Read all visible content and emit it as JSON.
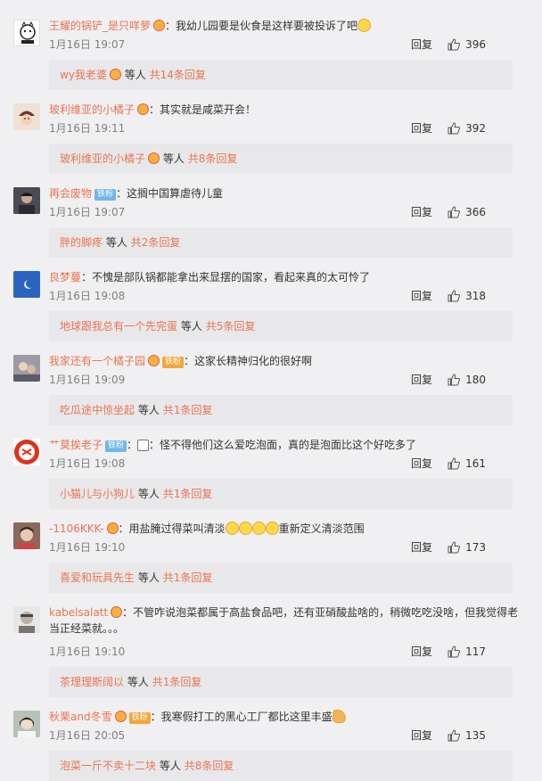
{
  "reply_label": "回复",
  "sub_mid": "等人",
  "comments": [
    {
      "user": "王耀的锅铲_是只咩萝",
      "badge": "v",
      "text": "：我幼儿园要是伙食是这样要被投诉了吧",
      "emoji": "sweat",
      "time": "1月16日 19:07",
      "likes": "396",
      "sub_user": "wy我老婆",
      "sub_badge": "v",
      "sub_count": "共14条回复",
      "avatar_color": "#ffffff"
    },
    {
      "user": "玻利维亚的小橘子",
      "badge": "v",
      "text": "：其实就是咸菜开会！",
      "time": "1月16日 19:11",
      "likes": "392",
      "sub_user": "玻利维亚的小橘子",
      "sub_badge": "v",
      "sub_count": "共8条回复",
      "avatar_color": "#e9d6c6"
    },
    {
      "user": "再会废物",
      "fan": "铁粉",
      "text": "：这搁中国算虐待儿童",
      "time": "1月16日 19:07",
      "likes": "366",
      "sub_user": "胖的脚疼",
      "sub_count": "共2条回复",
      "avatar_color": "#3a3c44"
    },
    {
      "user": "良梦蔓",
      "text": "：不愧是部队锅都能拿出来显摆的国家，看起来真的太可怜了",
      "time": "1月16日 19:08",
      "likes": "318",
      "sub_user": "地球跟我总有一个先完蛋",
      "sub_count": "共5条回复",
      "avatar_color": "#2f6fc7"
    },
    {
      "user": "我家还有一个橘子园",
      "badge": "v",
      "fan_gold": "铁粉",
      "text": "：这家长精神归化的很好啊",
      "time": "1月16日 19:09",
      "likes": "180",
      "sub_user": "吃瓜途中惊坐起",
      "sub_count": "共1条回复",
      "avatar_color": "#8a8a9a"
    },
    {
      "user": "艹莫挨老子",
      "fan": "铁粉",
      "text": "：怪不得他们这么爱吃泡面，真的是泡面比这个好吃多了",
      "emoji_pre": "tiny",
      "time": "1月16日 19:08",
      "likes": "161",
      "sub_user": "小猫儿与小狗儿",
      "sub_count": "共1条回复",
      "avatar_color": "#e0301e"
    },
    {
      "user": "-1106KKK-",
      "badge": "v",
      "text": "：用盐腌过得菜叫清淡",
      "text2": "重新定义清淡范围",
      "emoji_row": 4,
      "time": "1月16日 19:10",
      "likes": "173",
      "sub_user": "喜爱和玩具先生",
      "sub_count": "共1条回复",
      "avatar_color": "#7a5a50"
    },
    {
      "user": "kabelsalatt",
      "badge": "v",
      "text": "：不管咋说泡菜都属于高盐食品吧，还有亚硝酸盐啥的，稍微吃吃没啥，但我觉得老当正经菜就。。。",
      "time": "1月16日 19:10",
      "likes": "117",
      "sub_user": "茶理理斯阔以",
      "sub_count": "共1条回复",
      "avatar_color": "#d9d9d9"
    },
    {
      "user": "秋栗and冬雪",
      "badge": "v",
      "fan_gold": "铁粉",
      "text": "：我寒假打工的黑心工厂都比这里丰盛",
      "emoji": "hands",
      "time": "1月16日 20:05",
      "likes": "135",
      "sub_user": "泡菜一斤不卖十二块",
      "sub_count": "共8条回复",
      "avatar_color": "#a9b4a8"
    }
  ]
}
